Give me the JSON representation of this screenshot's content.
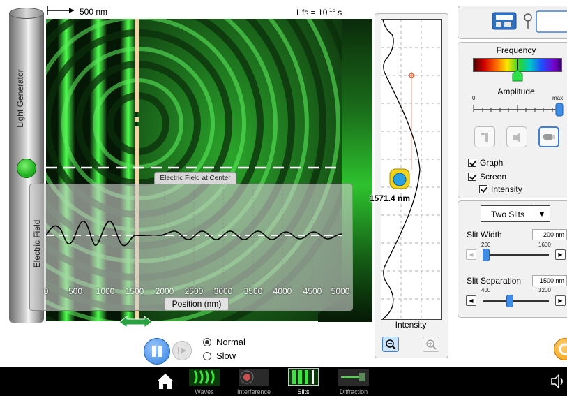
{
  "wave_view": {
    "scale_label": "500 nm",
    "time_label_prefix": "1 fs = 10",
    "time_label_exponent": "-15",
    "time_label_unit": " s"
  },
  "light_generator": {
    "label": "Light Generator"
  },
  "graph": {
    "title": "Electric Field at Center",
    "ylabel": "Electric Field",
    "xlabel": "Position (nm)",
    "x_ticks": [
      "0",
      "500",
      "1000",
      "1500",
      "2000",
      "2500",
      "3000",
      "3500",
      "4000",
      "4500",
      "5000"
    ]
  },
  "playback": {
    "normal_label": "Normal",
    "slow_label": "Slow",
    "selected": "Normal"
  },
  "intensity": {
    "label": "Intensity",
    "detector_distance": "1571.4 nm"
  },
  "controls": {
    "frequency_label": "Frequency",
    "amplitude_label": "Amplitude",
    "amplitude_min": "0",
    "amplitude_max": "max",
    "amplitude_value": 1.0,
    "graph_label": "Graph",
    "screen_label": "Screen",
    "intensity_label": "Intensity"
  },
  "slits": {
    "type": "Two Slits",
    "width_label": "Slit Width",
    "width_value": "200 nm",
    "width_min": "200",
    "width_max": "1600",
    "separation_label": "Slit Separation",
    "separation_value": "1500 nm",
    "separation_min": "400",
    "separation_max": "3200"
  },
  "nav": {
    "tabs": [
      "Waves",
      "Interference",
      "Slits",
      "Diffraction"
    ],
    "active": "Slits"
  },
  "colors": {
    "wave_green": "#22c622",
    "accent_blue": "#3f7fd5",
    "reset_orange": "#f29d00"
  }
}
